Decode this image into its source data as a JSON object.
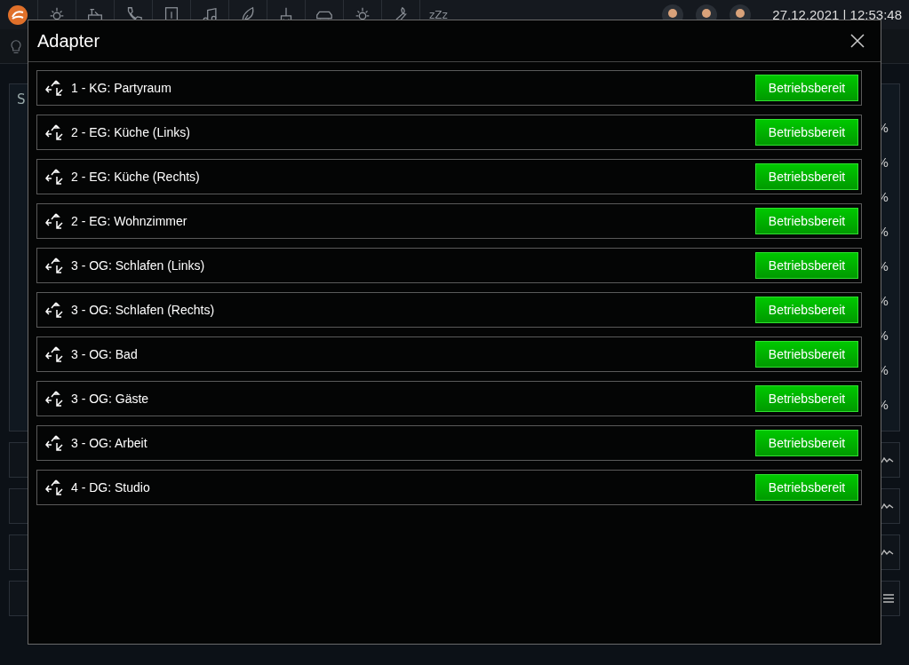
{
  "top_bar": {
    "sleep_label": "zZz",
    "datetime": "27.12.2021 | 12:53:48"
  },
  "background": {
    "left_panel_title": "S",
    "right_values": [
      "%",
      "%",
      "%",
      "%",
      "%",
      "%",
      "%",
      "%",
      "%"
    ]
  },
  "modal": {
    "title": "Adapter",
    "adapters": [
      {
        "name": "1 - KG: Partyraum",
        "status": "Betriebsbereit"
      },
      {
        "name": "2 - EG: Küche (Links)",
        "status": "Betriebsbereit"
      },
      {
        "name": "2 - EG: Küche (Rechts)",
        "status": "Betriebsbereit"
      },
      {
        "name": "2 - EG: Wohnzimmer",
        "status": "Betriebsbereit"
      },
      {
        "name": "3 - OG: Schlafen (Links)",
        "status": "Betriebsbereit"
      },
      {
        "name": "3 - OG: Schlafen (Rechts)",
        "status": "Betriebsbereit"
      },
      {
        "name": "3 - OG: Bad",
        "status": "Betriebsbereit"
      },
      {
        "name": "3 - OG: Gäste",
        "status": "Betriebsbereit"
      },
      {
        "name": "3 - OG: Arbeit",
        "status": "Betriebsbereit"
      },
      {
        "name": "4 - DG: Studio",
        "status": "Betriebsbereit"
      }
    ]
  }
}
